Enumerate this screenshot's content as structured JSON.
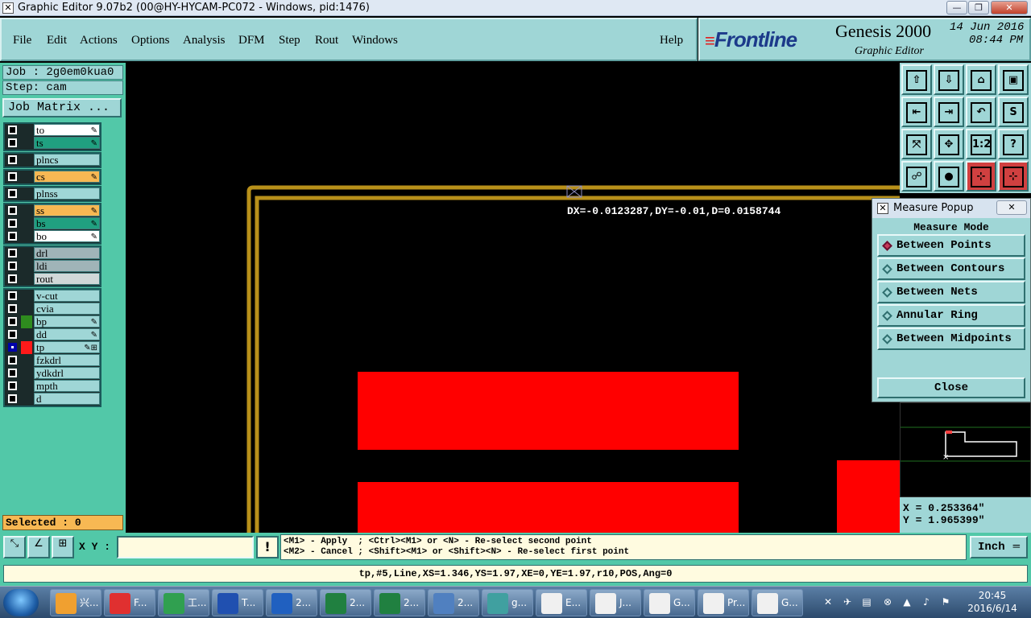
{
  "window": {
    "title": "Graphic Editor 9.07b2 (00@HY-HYCAM-PC072 - Windows, pid:1476)",
    "minimize": "—",
    "restore": "❐",
    "close": "✕"
  },
  "menu": [
    "File",
    "Edit",
    "Actions",
    "Options",
    "Analysis",
    "DFM",
    "Step",
    "Rout",
    "Windows"
  ],
  "menu_help": "Help",
  "brand": {
    "logo": "Frontline",
    "product": "Genesis 2000",
    "subtitle": "Graphic Editor",
    "date": "14 Jun 2016",
    "time": "08:44 PM"
  },
  "job": {
    "job_label": "Job : 2g0em0kua0",
    "step_label": "Step: cam",
    "matrix_button": "Job Matrix ..."
  },
  "layers": {
    "groups": [
      [
        {
          "name": "to",
          "color": "#ffffff",
          "mark": "✎"
        },
        {
          "name": "ts",
          "color": "#20a080",
          "mark": "✎"
        }
      ],
      [
        {
          "name": "plncs",
          "color": "#9fd6d6",
          "mark": ""
        }
      ],
      [
        {
          "name": "cs",
          "color": "#f7b853",
          "mark": "✎"
        }
      ],
      [
        {
          "name": "plnss",
          "color": "#9fd6d6",
          "mark": ""
        }
      ],
      [
        {
          "name": "ss",
          "color": "#f7b853",
          "mark": "✎"
        },
        {
          "name": "bs",
          "color": "#20a080",
          "mark": "✎"
        },
        {
          "name": "bo",
          "color": "#ffffff",
          "mark": "✎"
        }
      ],
      [
        {
          "name": "drl",
          "color": "#a0b4b8",
          "mark": ""
        },
        {
          "name": "ldi",
          "color": "#a0b4b8",
          "mark": ""
        },
        {
          "name": "rout",
          "color": "#d0d8d8",
          "mark": ""
        }
      ],
      [
        {
          "name": "v-cut",
          "color": "#9fd6d6",
          "mark": ""
        },
        {
          "name": "cvia",
          "color": "#9fd6d6",
          "mark": ""
        },
        {
          "name": "bp",
          "color": "#9fd6d6",
          "mark": "✎"
        },
        {
          "name": "dd",
          "color": "#9fd6d6",
          "mark": "✎"
        },
        {
          "name": "tp",
          "color": "#9fd6d6",
          "mark": "✎⊞"
        },
        {
          "name": "fzkdrl",
          "color": "#9fd6d6",
          "mark": ""
        },
        {
          "name": "ydkdrl",
          "color": "#9fd6d6",
          "mark": ""
        },
        {
          "name": "mpth",
          "color": "#9fd6d6",
          "mark": ""
        },
        {
          "name": "d",
          "color": "#9fd6d6",
          "mark": ""
        }
      ]
    ],
    "swatches": {
      "bp": "#2e8b1e",
      "tp": "#ff1a1a"
    },
    "active": "tp"
  },
  "selected": "Selected : 0",
  "canvas": {
    "measure_text": "DX=-0.0123287,DY=-0.01,D=0.0158744",
    "outline_color": "#b8901a",
    "pad_color": "#ff0000"
  },
  "tools": [
    [
      "⇧",
      "⇩",
      "⌂",
      "▣"
    ],
    [
      "⇤",
      "⇥",
      "↶",
      "S"
    ],
    [
      "⤧",
      "✥",
      "1:2",
      "?"
    ],
    [
      "☍",
      "●",
      "⊹",
      "⊹"
    ]
  ],
  "measure_popup": {
    "title": "Measure Popup",
    "mode_label": "Measure Mode",
    "options": [
      "Between Points",
      "Between Contours",
      "Between Nets",
      "Annular Ring",
      "Between Midpoints"
    ],
    "selected": "Between Points",
    "close": "Close"
  },
  "coords": {
    "x": "X = 0.253364\"",
    "y": "Y = 1.965399\""
  },
  "bottom": {
    "xy_label": "X Y :",
    "xy_value": "",
    "warn": "!",
    "prompt": "<M1> - Apply  ; <Ctrl><M1> or <N> - Re-select second point\n<M2> - Cancel ; <Shift><M1> or <Shift><N> - Re-select first point",
    "unit": "Inch",
    "status": "tp,#5,Line,XS=1.346,YS=1.97,XE=0,YE=1.97,r10,POS,Ang=0"
  },
  "taskbar": {
    "items": [
      {
        "label": "兴...",
        "color": "#f0a030"
      },
      {
        "label": "F...",
        "color": "#e03030"
      },
      {
        "label": "工...",
        "color": "#30a050"
      },
      {
        "label": "T...",
        "color": "#2050b0"
      },
      {
        "label": "2...",
        "color": "#2060c0"
      },
      {
        "label": "2...",
        "color": "#208040"
      },
      {
        "label": "2...",
        "color": "#208040"
      },
      {
        "label": "2...",
        "color": "#5080c0"
      },
      {
        "label": "g...",
        "color": "#40a0a0"
      },
      {
        "label": "E...",
        "color": "#f0f0f0"
      },
      {
        "label": "J...",
        "color": "#f0f0f0"
      },
      {
        "label": "G...",
        "color": "#f0f0f0"
      },
      {
        "label": "Pr...",
        "color": "#f0f0f0"
      },
      {
        "label": "G...",
        "color": "#f0f0f0"
      }
    ],
    "clock_time": "20:45",
    "clock_date": "2016/6/14"
  }
}
